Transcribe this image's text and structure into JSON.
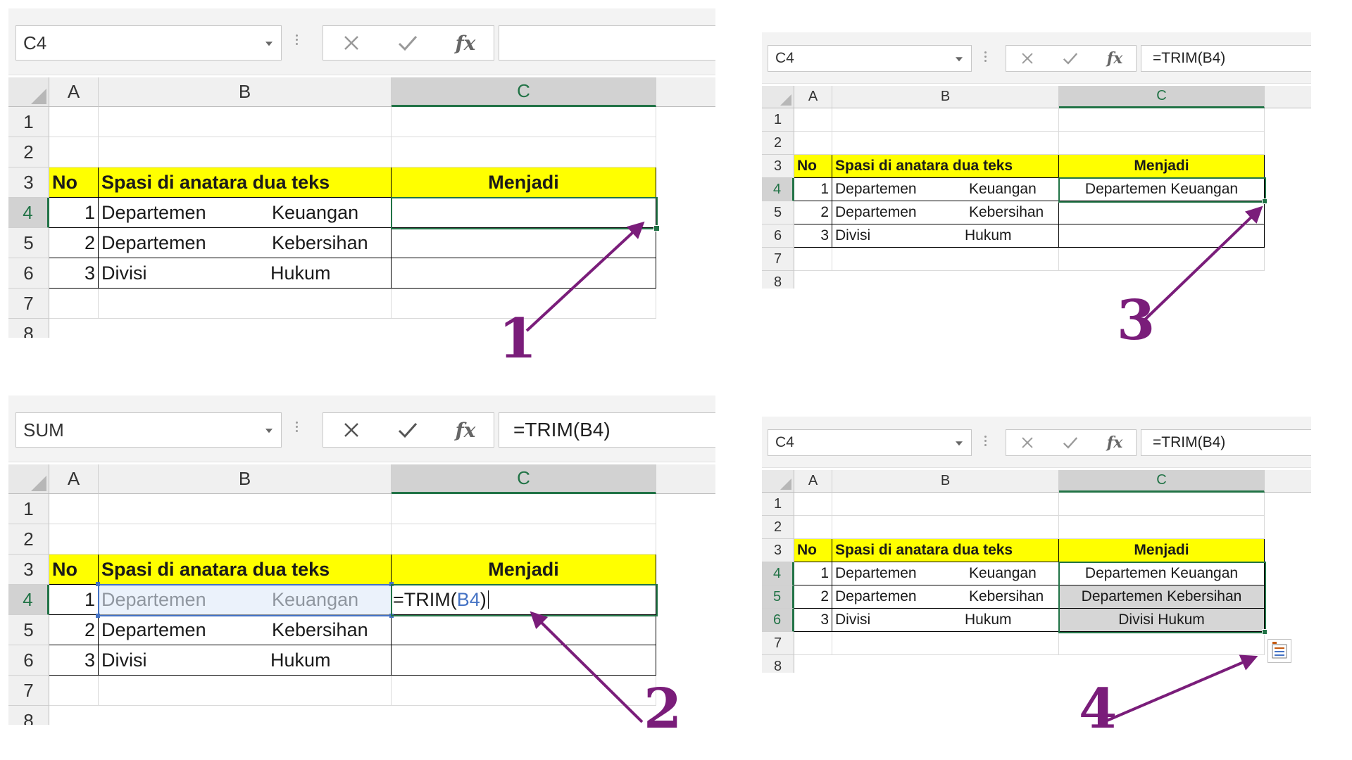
{
  "colors": {
    "arrow": "#7a1d7a",
    "header_fill": "#ffff00",
    "selection": "#217346",
    "reference": "#4472c4"
  },
  "toolbar": {
    "cancel_icon": "close-icon",
    "enter_icon": "check-icon",
    "fx_label": "fx"
  },
  "columns": [
    "A",
    "B",
    "C"
  ],
  "rows": [
    "1",
    "2",
    "3",
    "4",
    "5",
    "6",
    "7",
    "8"
  ],
  "table": {
    "headers": {
      "no": "No",
      "text": "Spasi di anatara dua teks",
      "result": "Menjadi"
    },
    "records": [
      {
        "no": "1",
        "word1": "Departemen",
        "word2": "Keuangan",
        "result": "Departemen Keuangan"
      },
      {
        "no": "2",
        "word1": "Departemen",
        "word2": "Kebersihan",
        "result": "Departemen Kebersihan"
      },
      {
        "no": "3",
        "word1": "Divisi",
        "word2": "Hukum",
        "result": "Divisi Hukum"
      }
    ]
  },
  "panels": [
    {
      "step": "1",
      "name_box": "C4",
      "formula": ""
    },
    {
      "step": "2",
      "name_box": "SUM",
      "formula": "=TRIM(B4)",
      "editing_prefix": "=TRIM(",
      "editing_ref": "B4",
      "editing_suffix": ")"
    },
    {
      "step": "3",
      "name_box": "C4",
      "formula": "=TRIM(B4)"
    },
    {
      "step": "4",
      "name_box": "C4",
      "formula": "=TRIM(B4)"
    }
  ]
}
